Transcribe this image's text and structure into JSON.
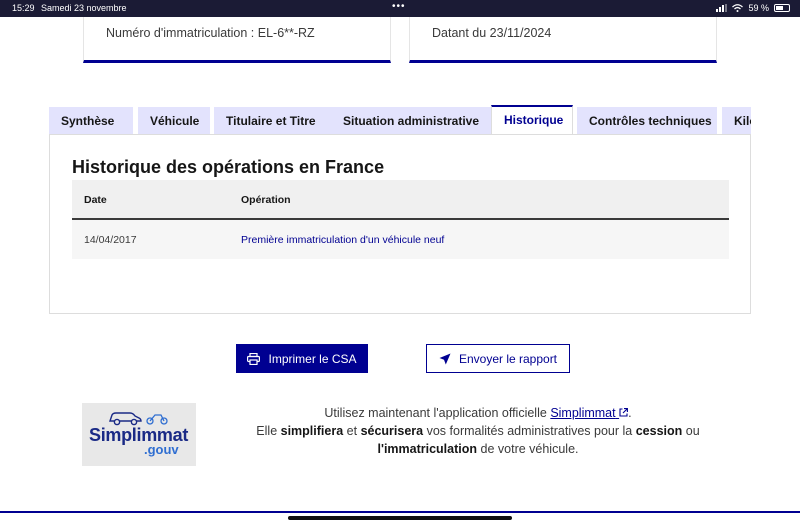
{
  "status_bar": {
    "time": "15:29",
    "date": "Samedi 23 novembre",
    "battery": "59 %"
  },
  "cards": {
    "registration": "Numéro d'immatriculation : EL-6**-RZ",
    "dated": "Datant du 23/11/2024"
  },
  "tabs": [
    {
      "label": "Synthèse"
    },
    {
      "label": "Véhicule"
    },
    {
      "label": "Titulaire et Titre"
    },
    {
      "label": "Situation administrative"
    },
    {
      "label": "Historique",
      "active": true
    },
    {
      "label": "Contrôles techniques"
    },
    {
      "label": "Kilo"
    }
  ],
  "history": {
    "title": "Historique des opérations en France",
    "columns": [
      "Date",
      "Opération"
    ],
    "rows": [
      {
        "date": "14/04/2017",
        "operation": "Première immatriculation d'un véhicule neuf"
      }
    ]
  },
  "buttons": {
    "print": "Imprimer le CSA",
    "send": "Envoyer le rapport"
  },
  "logo": {
    "brand": "Simplimmat",
    "suffix": ".gouv"
  },
  "info": {
    "line1_prefix": "Utilisez maintenant l'application officielle",
    "link": "Simplimmat",
    "line1_suffix": ".",
    "line2_prefix": "Elle",
    "bold1": "simplifiera",
    "and": "et",
    "bold2": "sécurisera",
    "line2_middle": "vos formalités administratives pour la",
    "bold3": "cession",
    "or": "ou",
    "bold4": "l'immatriculation",
    "line3_suffix": "de votre véhicule."
  },
  "colors": {
    "primary": "#000091",
    "tab_inactive": "#e3e3fd",
    "status_bar": "#1b1b35"
  }
}
